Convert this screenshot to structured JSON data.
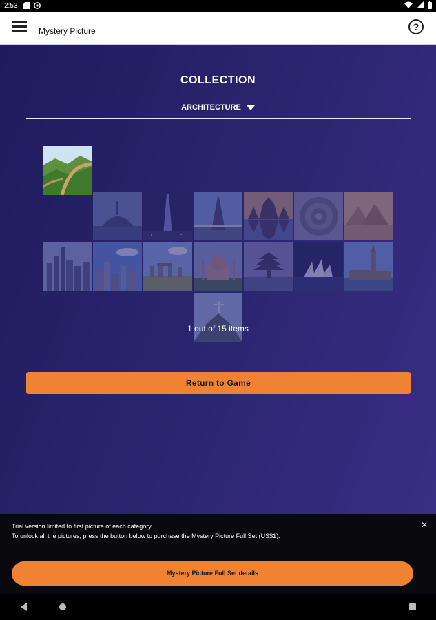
{
  "status_bar": {
    "time": "2:53"
  },
  "app_bar": {
    "title": "Mystery Picture",
    "help_glyph": "?"
  },
  "collection": {
    "title": "COLLECTION",
    "category": "ARCHITECTURE",
    "count_text": "1 out of 15 items",
    "items": [
      {
        "icon": "great-wall-picture",
        "unlocked": true
      },
      {
        "icon": "mont-saint-michel-picture",
        "unlocked": false
      },
      {
        "icon": "tokyo-skytree-picture",
        "unlocked": false
      },
      {
        "icon": "eiffel-tower-picture",
        "unlocked": false
      },
      {
        "icon": "angkor-wat-picture",
        "unlocked": false
      },
      {
        "icon": "borobudur-picture",
        "unlocked": false
      },
      {
        "icon": "pyramids-picture",
        "unlocked": false
      },
      {
        "icon": "new-york-skyline-picture",
        "unlocked": false
      },
      {
        "icon": "city-skyline-picture",
        "unlocked": false
      },
      {
        "icon": "stonehenge-picture",
        "unlocked": false
      },
      {
        "icon": "taj-mahal-picture",
        "unlocked": false
      },
      {
        "icon": "pagoda-temple-picture",
        "unlocked": false
      },
      {
        "icon": "sydney-opera-house-picture",
        "unlocked": false
      },
      {
        "icon": "big-ben-picture",
        "unlocked": false
      },
      {
        "icon": "christ-redeemer-picture",
        "unlocked": false
      }
    ]
  },
  "return_button": "Return to Game",
  "trial": {
    "line1": "Trial version limited to first picture of each category.",
    "line2": "To unlock all the pictures, press the button below to purchase the Mystery Picture Full Set (US$1).",
    "close_glyph": "✕",
    "button": "Mystery Picture Full Set details"
  }
}
